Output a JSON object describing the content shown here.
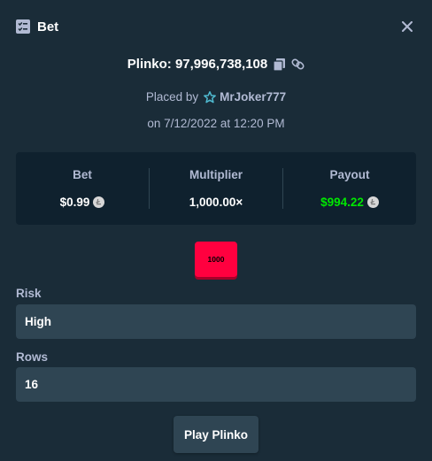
{
  "header": {
    "title": "Bet",
    "icon": "bet-slip-icon",
    "close_icon": "close-icon"
  },
  "bet": {
    "title": "Plinko: 97,996,738,108",
    "placed_by_prefix": "Placed by",
    "username": "MrJoker777",
    "date": "on 7/12/2022 at 12:20 PM"
  },
  "stats": {
    "bet": {
      "label": "Bet",
      "value": "$0.99"
    },
    "multiplier": {
      "label": "Multiplier",
      "value": "1,000.00×"
    },
    "payout": {
      "label": "Payout",
      "value": "$994.22"
    }
  },
  "result": {
    "multiplier_slot": "1000"
  },
  "form": {
    "risk": {
      "label": "Risk",
      "value": "High"
    },
    "rows": {
      "label": "Rows",
      "value": "16"
    }
  },
  "play_button": {
    "label": "Play Plinko"
  },
  "colors": {
    "background": "#1a2c38",
    "panel": "#0f212e",
    "input": "#2f4553",
    "muted_text": "#b1bad3",
    "payout_green": "#00e701",
    "slot_red": "#ff003f"
  }
}
